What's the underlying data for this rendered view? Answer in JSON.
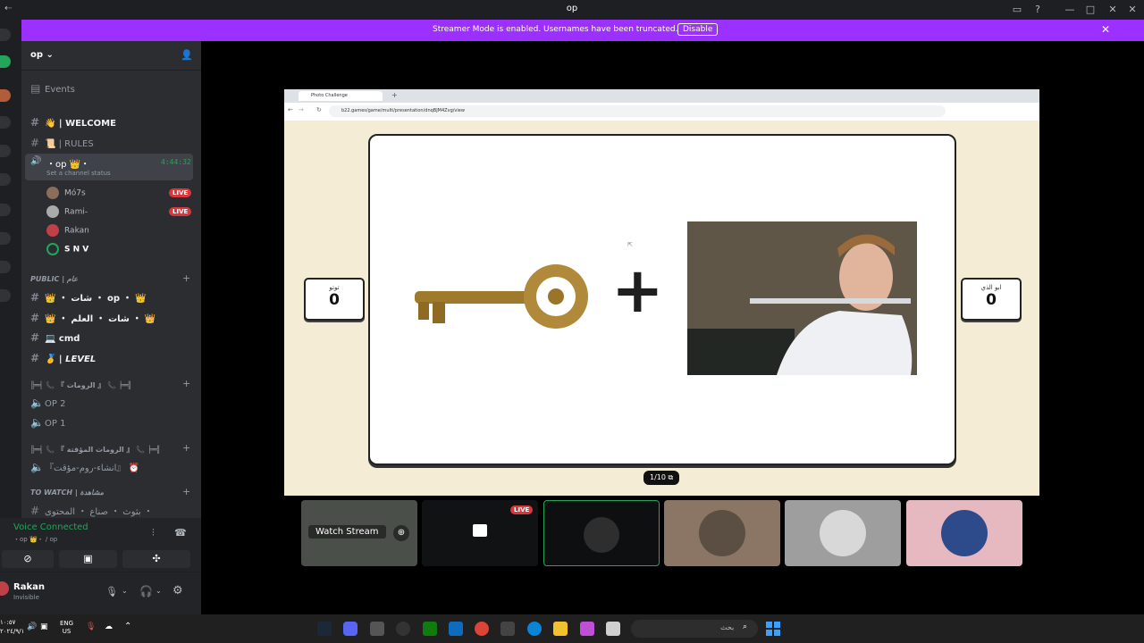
{
  "window": {
    "title": "op"
  },
  "banner": {
    "message": "Streamer Mode is enabled. Usernames have been truncated.",
    "disable_label": "Disable"
  },
  "server": {
    "name": "op"
  },
  "sidebar": {
    "events_label": "Events",
    "channels_top": [
      {
        "label": "👋 | WELCOME"
      },
      {
        "label": "📜 | RULES"
      }
    ],
    "active_voice": {
      "label": "・op 👑・",
      "timer": "4:44:32",
      "status": "Set a channel status"
    },
    "voice_users": [
      {
        "name": "Mó7s",
        "live": true
      },
      {
        "name": "Rami-",
        "live": true
      },
      {
        "name": "Rakan",
        "live": false
      },
      {
        "name": "S N V",
        "live": false
      }
    ],
    "live_label": "LIVE",
    "category_public": "PUBLIC | عام",
    "public_channels": [
      {
        "label": "👑 ・ شات ・ op ・ 👑"
      },
      {
        "label": "👑 ・ شات ・ العلم ・ 👑"
      },
      {
        "label": "💻 cmd"
      },
      {
        "label": "🥇 | LEVEL"
      }
    ],
    "category_rooms": "╠═╡ 📞 『 الرومات 』 📞 ╞═╣",
    "room_channels": [
      {
        "label": "OP 2"
      },
      {
        "label": "OP 1"
      }
    ],
    "category_temp": "╠═╡ 📞 『 الرومات المؤقتة 』 📞 ╞═╣",
    "temp_channels": [
      {
        "label": "『انشاء-روم-مؤقت』 ⏰"
      }
    ],
    "category_watch": "TO WATCH | مشاهدة",
    "watch_channels": [
      {
        "label": "بثوث ・ صناع ・ المحتوى ・"
      }
    ]
  },
  "voice_panel": {
    "status": "Voice Connected",
    "channel": "・op 👑・ / op"
  },
  "user_panel": {
    "name": "Rakan",
    "status": "Invisible"
  },
  "stream": {
    "game_title": "Photo Challenge",
    "url": "b22.games/game/multi/presentation/dnqBJM4Zvg/view",
    "left_team": {
      "name": "توتو",
      "score": "0"
    },
    "right_team": {
      "name": "ابو الذي",
      "score": "0"
    },
    "counter": "1/10",
    "plus_symbol": "+"
  },
  "tiles": {
    "watch_label": "Watch Stream",
    "live_label": "LIVE"
  },
  "taskbar": {
    "lang_top": "ENG",
    "lang_bottom": "US",
    "time": "١٠:٥٧",
    "date": "٢٠٢٤/٩/١",
    "search_placeholder": "بحث"
  },
  "colors": {
    "banner": "#9b30ff",
    "live": "#da373c",
    "voice_green": "#23a55a",
    "sidebar": "#2b2d31"
  }
}
